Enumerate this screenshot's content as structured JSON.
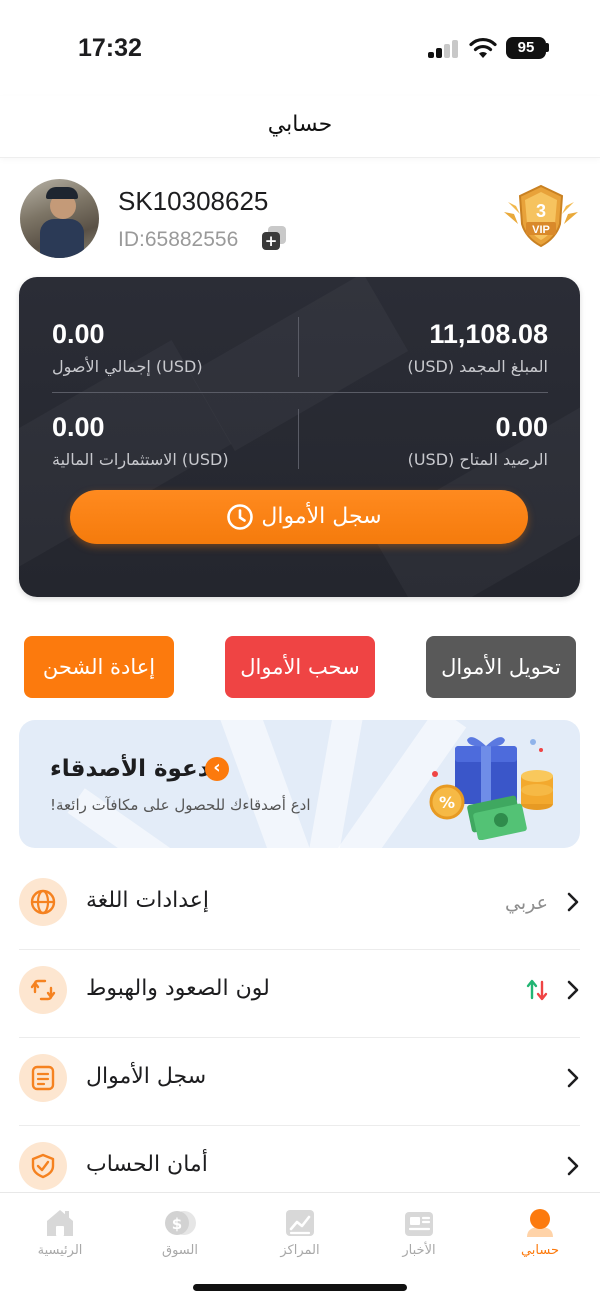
{
  "status_bar": {
    "time": "17:32",
    "battery": "95"
  },
  "header": {
    "title": "حسابي"
  },
  "profile": {
    "username": "SK10308625",
    "user_id": "ID:65882556",
    "vip_level": "3",
    "vip_text": "VIP"
  },
  "balance_card": {
    "frozen_amount": {
      "value": "11,108.08",
      "label": "(USD)  المبلغ المجمد"
    },
    "total_assets": {
      "value": "0.00",
      "label": "(USD)  إجمالي الأصول"
    },
    "available_balance": {
      "value": "0.00",
      "label": "(USD)  الرصيد المتاح"
    },
    "financial_investments": {
      "value": "0.00",
      "label": "(USD)  الاستثمارات المالية"
    },
    "history_button": "سجل الأموال"
  },
  "actions": {
    "transfer": "تحويل الأموال",
    "withdraw": "سحب الأموال",
    "recharge": "إعادة الشحن"
  },
  "invite": {
    "title": "دعوة الأصدقاء",
    "subtitle": "!ادع أصدقاءك للحصول على مكافآت رائعة"
  },
  "settings": [
    {
      "label": "إعدادات اللغة",
      "value": "عربي",
      "icon": "globe-icon"
    },
    {
      "label": "لون الصعود والهبوط",
      "value": "",
      "icon": "up-down-arrows-icon"
    },
    {
      "label": "سجل الأموال",
      "value": "",
      "icon": "document-icon"
    },
    {
      "label": "أمان الحساب",
      "value": "",
      "icon": "shield-check-icon"
    }
  ],
  "tabs": [
    {
      "label": "حسابي",
      "icon": "profile-icon",
      "active": true
    },
    {
      "label": "الأخبار",
      "icon": "news-icon",
      "active": false
    },
    {
      "label": "المراكز",
      "icon": "chart-icon",
      "active": false
    },
    {
      "label": "السوق",
      "icon": "dollar-coin-icon",
      "active": false
    },
    {
      "label": "الرئيسية",
      "icon": "home-icon",
      "active": false
    }
  ],
  "colors": {
    "accent": "#fc7a0d",
    "card_bg": "#24262e",
    "withdraw": "#ef4444",
    "transfer": "#595959"
  }
}
